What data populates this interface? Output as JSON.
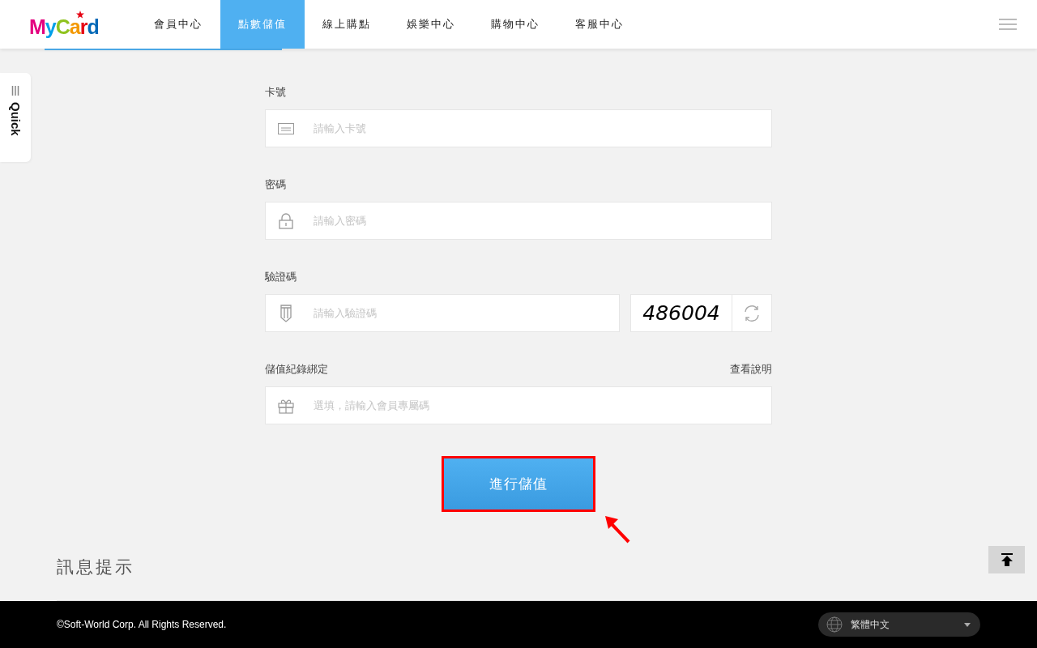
{
  "logo": "MyCard",
  "nav": [
    {
      "label": "會員中心",
      "selected": false
    },
    {
      "label": "點數儲值",
      "selected": true
    },
    {
      "label": "線上購點",
      "selected": false
    },
    {
      "label": "娛樂中心",
      "selected": false
    },
    {
      "label": "購物中心",
      "selected": false
    },
    {
      "label": "客服中心",
      "selected": false
    }
  ],
  "quick_tab": {
    "label": "Quick"
  },
  "form": {
    "fields": [
      {
        "kind": "card",
        "label": "卡號",
        "placeholder": "請輸入卡號"
      },
      {
        "kind": "lock",
        "label": "密碼",
        "placeholder": "請輸入密碼"
      },
      {
        "kind": "captcha",
        "label": "驗證碼",
        "placeholder": "請輸入驗證碼",
        "code": "486004"
      },
      {
        "kind": "gift",
        "label": "儲值紀錄綁定",
        "placeholder": "選填，請輸入會員專屬碼",
        "help_link": "查看說明"
      }
    ],
    "submit": {
      "label": "進行儲值",
      "highlighted": true
    }
  },
  "notice": {
    "title": "訊息提示"
  },
  "footer": {
    "copyright": "©Soft-World Corp. All Rights Reserved.",
    "language": "繁體中文"
  }
}
